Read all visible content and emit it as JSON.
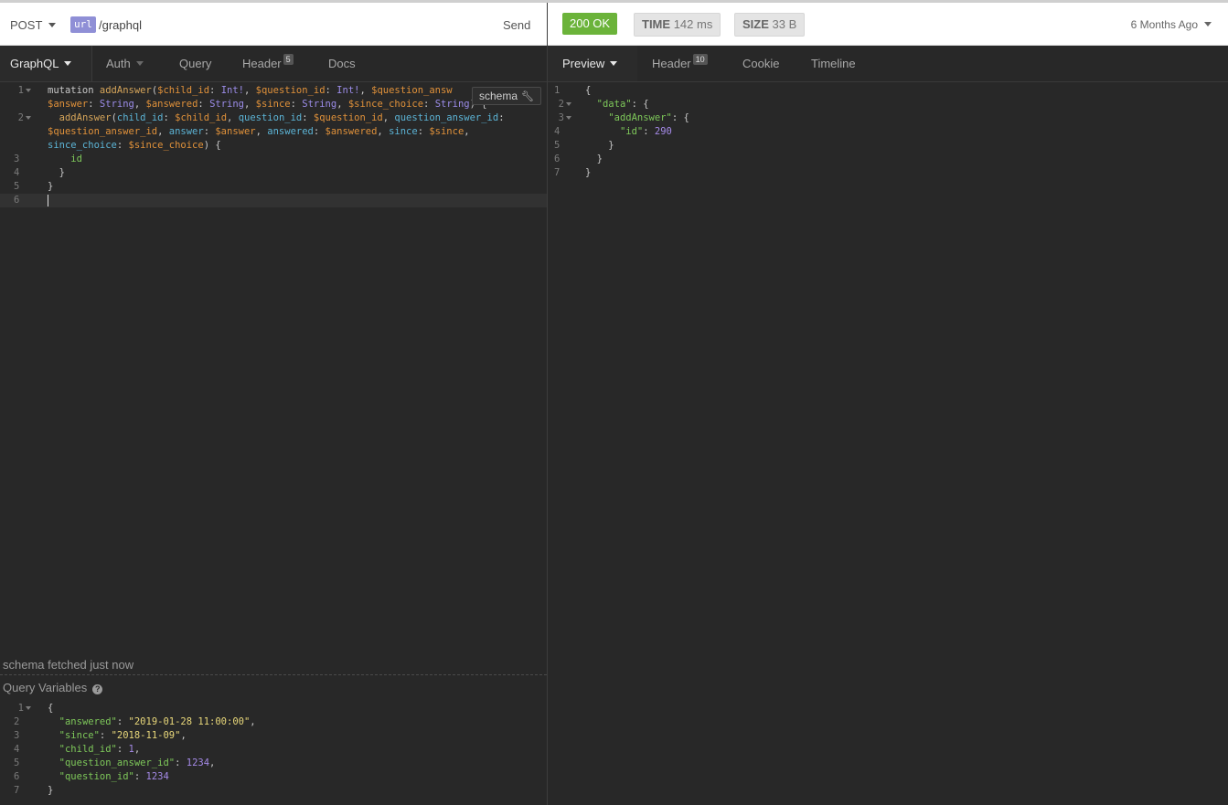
{
  "request": {
    "method": "POST",
    "url_tag": "url",
    "url_path": "/graphql",
    "send_label": "Send"
  },
  "left_tabs": [
    {
      "label": "GraphQL"
    },
    {
      "label": "Auth"
    },
    {
      "label": "Query"
    },
    {
      "label": "Header",
      "badge": "5"
    },
    {
      "label": "Docs"
    }
  ],
  "schema_button": "schema",
  "schema_status": "schema fetched just now",
  "query_variables_title": "Query Variables",
  "query_variables_line_numbers": [
    "1",
    "2",
    "3",
    "4",
    "5",
    "6",
    "7"
  ],
  "query_line_numbers": [
    "1",
    "2",
    "3",
    "4",
    "5",
    "6"
  ],
  "response": {
    "status": "200 OK",
    "time_label": "TIME",
    "time_value": "142 ms",
    "size_label": "SIZE",
    "size_value": "33 B",
    "age": "6 Months Ago",
    "line_numbers": [
      "1",
      "2",
      "3",
      "4",
      "5",
      "6",
      "7"
    ]
  },
  "right_tabs": [
    {
      "label": "Preview"
    },
    {
      "label": "Header",
      "badge": "10"
    },
    {
      "label": "Cookie"
    },
    {
      "label": "Timeline"
    }
  ],
  "query_tokens": {
    "mutation": "mutation",
    "op_name": "addAnswer",
    "child_id_var": "$child_id",
    "int_bang": "Int!",
    "question_id_var": "$question_id",
    "question_answer_id_var_part": "$question_answ",
    "answer_var": "$answer",
    "string_type": "String",
    "answered_var": "$answered",
    "since_var": "$since",
    "since_choice_var": "$since_choice",
    "field_addAnswer": "addAnswer",
    "arg_child_id": "child_id",
    "arg_question_id": "question_id",
    "arg_question_answer_id": "question_answer_id",
    "question_answer_id_var": "$question_answer_id",
    "arg_answer": "answer",
    "arg_answered": "answered",
    "arg_since": "since",
    "arg_since_choice": "since_choice",
    "field_id": "id"
  },
  "variables": {
    "answered_key": "\"answered\"",
    "answered_val": "\"2019-01-28 11:00:00\"",
    "since_key": "\"since\"",
    "since_val": "\"2018-11-09\"",
    "child_id_key": "\"child_id\"",
    "child_id_val": "1",
    "question_answer_id_key": "\"question_answer_id\"",
    "question_answer_id_val": "1234",
    "question_id_key": "\"question_id\"",
    "question_id_val": "1234"
  },
  "response_body": {
    "data_key": "\"data\"",
    "addAnswer_key": "\"addAnswer\"",
    "id_key": "\"id\"",
    "id_val": "290"
  },
  "colors": {
    "status_ok": "#6bb33a",
    "url_tag": "#8f8fd6",
    "editor_bg": "#282828"
  }
}
